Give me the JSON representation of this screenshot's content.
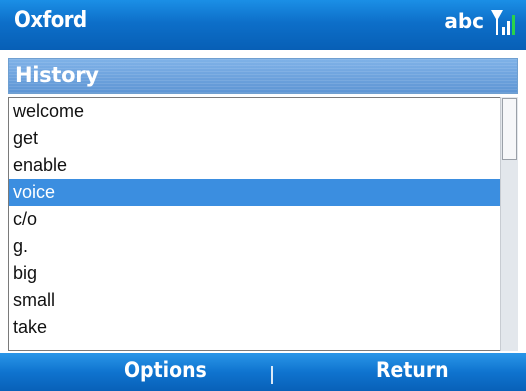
{
  "title_bar": {
    "app_title": "Oxford",
    "input_mode": "abc",
    "signal_icon": "signal-strength-icon"
  },
  "section": {
    "title": "History"
  },
  "history": {
    "items": [
      "welcome",
      "get",
      "enable",
      "voice",
      "c/o",
      "g.",
      "big",
      "small",
      "take"
    ],
    "selected_index": 3,
    "scroll_position": 0.0
  },
  "softkeys": {
    "left_label": "Options",
    "right_label": "Return"
  },
  "colors": {
    "title_bar": "#0d6fc9",
    "header": "#6fa3dd",
    "selection": "#3b8ee0"
  }
}
